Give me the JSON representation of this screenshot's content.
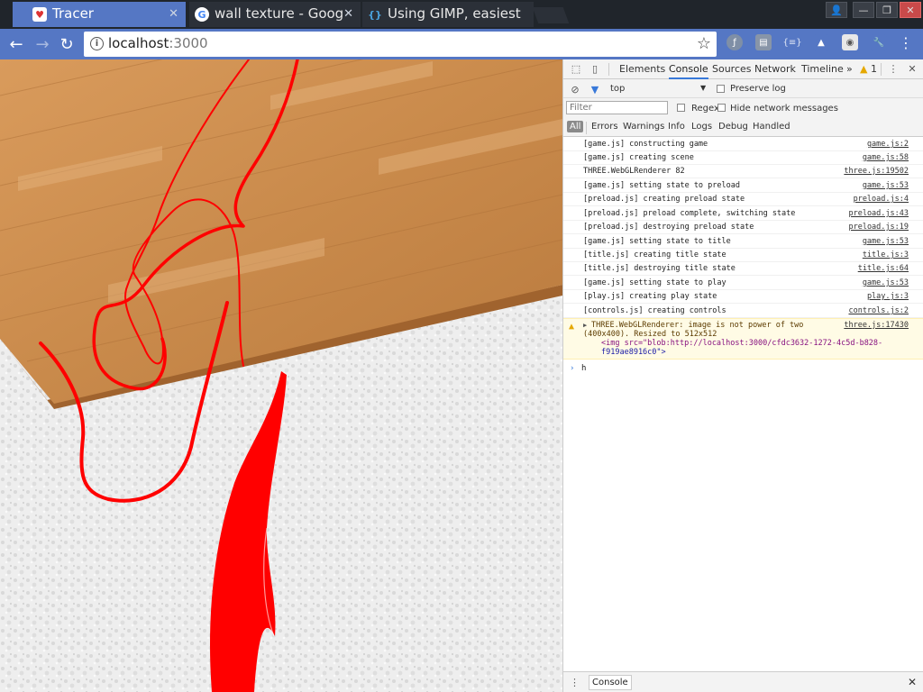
{
  "tabs": [
    {
      "title": "Tracer",
      "favicon": "tracer-icon",
      "active": true
    },
    {
      "title": "wall texture - Goog",
      "favicon": "google-icon",
      "active": false
    },
    {
      "title": "Using GIMP, easiest",
      "favicon": "stackoverflow-icon",
      "active": false
    }
  ],
  "address": {
    "host": "localhost",
    "port": ":3000"
  },
  "devtools": {
    "panel_tabs": [
      "Elements",
      "Console",
      "Sources",
      "Network",
      "Timeline"
    ],
    "active_panel": "Console",
    "more": "»",
    "warning_count": "1",
    "context": "top",
    "preserve_log": "Preserve log",
    "filter_placeholder": "Filter",
    "regex": "Regex",
    "hide_network": "Hide network messages",
    "levels": [
      "All",
      "Errors",
      "Warnings",
      "Info",
      "Logs",
      "Debug",
      "Handled"
    ],
    "logs": [
      {
        "msg": "[game.js] constructing game",
        "src": "game.js:2"
      },
      {
        "msg": "[game.js] creating scene",
        "src": "game.js:58"
      },
      {
        "msg": "THREE.WebGLRenderer 82",
        "src": "three.js:19502"
      },
      {
        "msg": "[game.js] setting state to preload",
        "src": "game.js:53"
      },
      {
        "msg": "[preload.js] creating preload state",
        "src": "preload.js:4"
      },
      {
        "msg": "[preload.js] preload complete, switching state",
        "src": "preload.js:43"
      },
      {
        "msg": "[preload.js] destroying preload state",
        "src": "preload.js:19"
      },
      {
        "msg": "[game.js] setting state to title",
        "src": "game.js:53"
      },
      {
        "msg": "[title.js] creating title state",
        "src": "title.js:3"
      },
      {
        "msg": "[title.js] destroying title state",
        "src": "title.js:64"
      },
      {
        "msg": "[game.js] setting state to play",
        "src": "game.js:53"
      },
      {
        "msg": "[play.js] creating play state",
        "src": "play.js:3"
      },
      {
        "msg": "[controls.js] creating controls",
        "src": "controls.js:2"
      }
    ],
    "warning": {
      "line1": "THREE.WebGLRenderer: image is not power of two",
      "line2": "(400x400). Resized to 512x512",
      "line3": "<img src=\"blob:http://localhost:3000/cfdc3632-1272-4c5d-b828-",
      "line4": "f919ae8916c0\">",
      "src": "three.js:17430"
    },
    "prompt_text": "h",
    "drawer_tab": "Console"
  },
  "colors": {
    "tab_active": "#5577c4",
    "toolbar": "#5577c4",
    "trace_red": "#ff0000",
    "wood": "#c98a4b"
  }
}
